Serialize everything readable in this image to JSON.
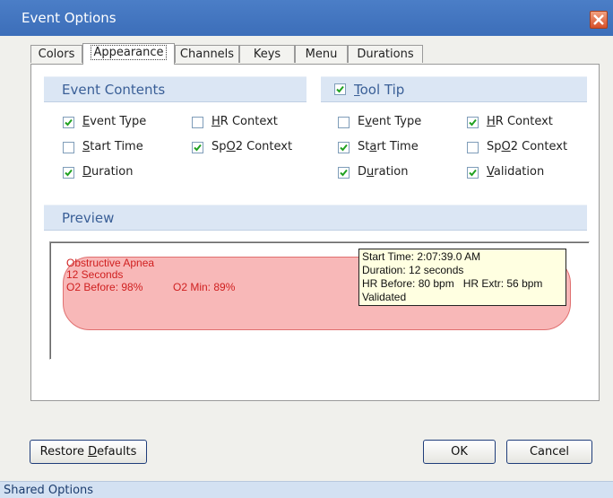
{
  "window": {
    "title": "Event Options"
  },
  "tabs": [
    {
      "label": "Colors"
    },
    {
      "label": "Appearance",
      "active": true
    },
    {
      "label": "Channels"
    },
    {
      "label": "Keys"
    },
    {
      "label": "Menu"
    },
    {
      "label": "Durations"
    }
  ],
  "event_contents": {
    "header": "Event Contents",
    "options": [
      {
        "label": "Event Type",
        "ul": "E",
        "checked": true
      },
      {
        "label": "HR Context",
        "ul": "H",
        "checked": false
      },
      {
        "label": "Start Time",
        "ul": "S",
        "checked": false
      },
      {
        "label": "SpO2 Context",
        "ul": "O",
        "checked": true
      },
      {
        "label": "Duration",
        "ul": "D",
        "checked": true
      }
    ]
  },
  "tool_tip": {
    "header": "Tool Tip",
    "checked": true,
    "options": [
      {
        "label": "Event Type",
        "ul": "v",
        "checked": false
      },
      {
        "label": "HR Context",
        "ul": "H",
        "checked": true
      },
      {
        "label": "Start Time",
        "ul": "a",
        "checked": true
      },
      {
        "label": "SpO2 Context",
        "ul": "O",
        "checked": false
      },
      {
        "label": "Duration",
        "ul": "u",
        "checked": true
      },
      {
        "label": "Validation",
        "ul": "V",
        "checked": true
      }
    ]
  },
  "preview": {
    "header": "Preview",
    "event_lines": [
      "Obstructive Apnea",
      "12 Seconds",
      "O2 Before: 98%",
      "O2 Min: 89%"
    ],
    "tooltip_lines": [
      "Start Time: 2:07:39.0 AM",
      "Duration: 12 seconds",
      "HR Before: 80 bpm   HR Extr: 56 bpm",
      "Validated"
    ]
  },
  "buttons": {
    "restore_defaults": "Restore Defaults",
    "restore_ul": "D",
    "ok": "OK",
    "cancel": "Cancel"
  },
  "status": {
    "text": "Shared Options"
  },
  "colors": {
    "accent": "#3c6eb9",
    "section_bg": "#dbe6f4",
    "event_fill": "#f8b8b8",
    "event_text": "#d02020",
    "tooltip_bg": "#ffffe1"
  }
}
